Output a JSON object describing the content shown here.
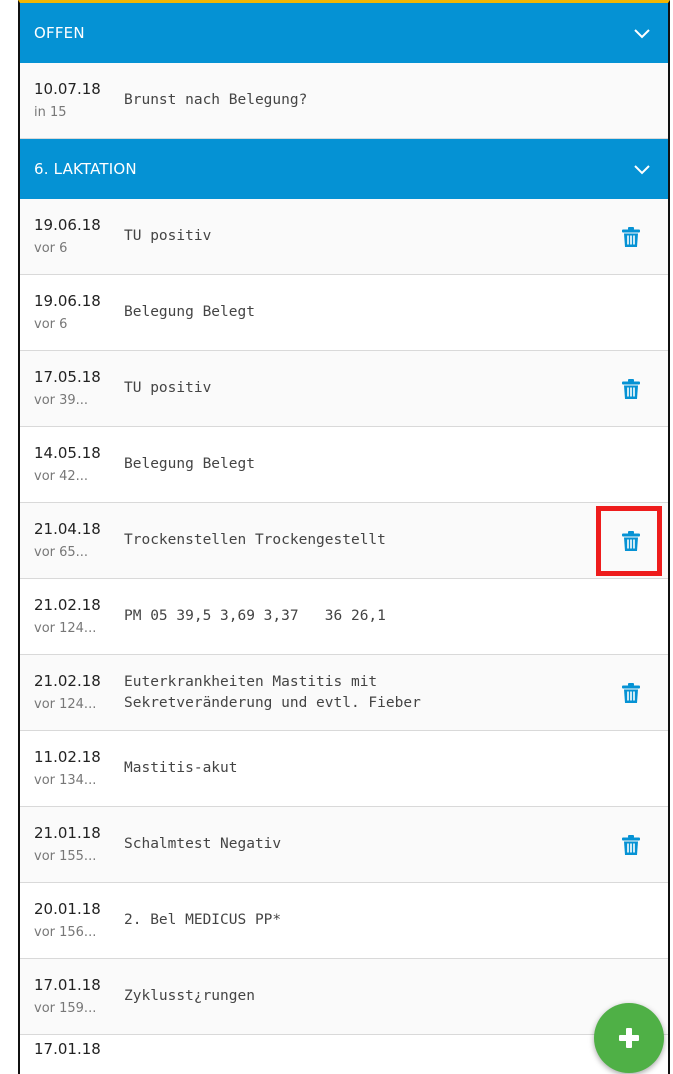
{
  "sections": [
    {
      "title": "OFFEN",
      "entries": [
        {
          "date": "10.07.18",
          "relative": "in 15",
          "text": "Brunst nach Belegung?",
          "deletable": false
        }
      ]
    },
    {
      "title": "6. LAKTATION",
      "entries": [
        {
          "date": "19.06.18",
          "relative": "vor 6",
          "text": "TU positiv",
          "deletable": true
        },
        {
          "date": "19.06.18",
          "relative": "vor 6",
          "text": "Belegung Belegt",
          "deletable": false
        },
        {
          "date": "17.05.18",
          "relative": "vor 39...",
          "text": "TU positiv",
          "deletable": true
        },
        {
          "date": "14.05.18",
          "relative": "vor 42...",
          "text": "Belegung Belegt",
          "deletable": false
        },
        {
          "date": "21.04.18",
          "relative": "vor 65...",
          "text": "Trockenstellen Trockengestellt",
          "deletable": true
        },
        {
          "date": "21.02.18",
          "relative": "vor 124...",
          "text": "PM 05 39,5 3,69 3,37   36 26,1",
          "deletable": false
        },
        {
          "date": "21.02.18",
          "relative": "vor 124...",
          "text": "Euterkrankheiten Mastitis mit\nSekretveränderung und evtl. Fieber",
          "deletable": true
        },
        {
          "date": "11.02.18",
          "relative": "vor 134...",
          "text": "Mastitis-akut",
          "deletable": false
        },
        {
          "date": "21.01.18",
          "relative": "vor 155...",
          "text": "Schalmtest Negativ",
          "deletable": true
        },
        {
          "date": "20.01.18",
          "relative": "vor 156...",
          "text": "2. Bel MEDICUS PP*",
          "deletable": false
        },
        {
          "date": "17.01.18",
          "relative": "vor 159...",
          "text": "Zyklusst¿rungen",
          "deletable": false
        }
      ]
    }
  ],
  "partial_next_date": "17.01.18",
  "icons": {
    "collapse": "chevron-down-icon",
    "delete": "trash-icon",
    "add": "plus-icon"
  },
  "colors": {
    "header": "#0592d4",
    "trash": "#0592d4",
    "fab": "#4fb046",
    "highlight": "#ee1c1c"
  }
}
